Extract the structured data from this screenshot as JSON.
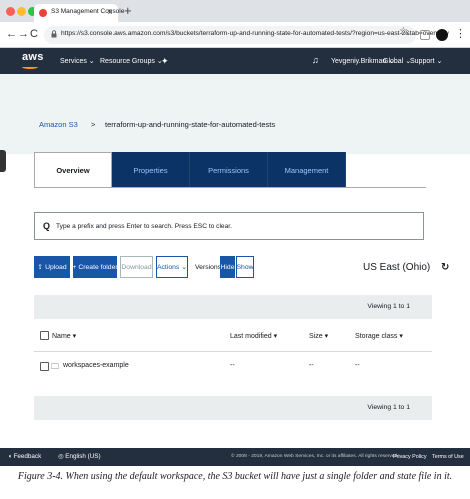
{
  "browser": {
    "tab_title": "S3 Management Console",
    "tab_close": "x",
    "new_tab": "+",
    "url": "https://s3.console.aws.amazon.com/s3/buckets/terraform-up-and-running-state-for-automated-tests/?region=us-east-2&tab=overview",
    "traffic_colors": [
      "#ff5f57",
      "#febc2e",
      "#28c840"
    ]
  },
  "aws_nav": {
    "logo": "aws",
    "services": "Services",
    "resource_groups": "Resource Groups",
    "user": "Yevgeniy.Brikman",
    "region": "Global",
    "support": "Support",
    "background": "#232f3e",
    "accent": "#ff9900"
  },
  "breadcrumb": {
    "root": "Amazon S3",
    "separator": ">",
    "bucket": "terraform-up-and-running-state-for-automated-tests"
  },
  "tabs": [
    {
      "label": "Overview",
      "active": true
    },
    {
      "label": "Properties",
      "active": false
    },
    {
      "label": "Permissions",
      "active": false
    },
    {
      "label": "Management",
      "active": false
    }
  ],
  "search": {
    "icon": "search-icon",
    "placeholder": "Type a prefix and press Enter to search. Press ESC to clear."
  },
  "toolbar": {
    "upload": "Upload",
    "create_folder": "Create folder",
    "download": "Download",
    "actions": "Actions",
    "versions_label": "Versions",
    "hide": "Hide",
    "show": "Show",
    "region": "US East (Ohio)"
  },
  "table": {
    "viewing_top": "Viewing 1 to 1",
    "viewing_bottom": "Viewing 1 to 1",
    "columns": {
      "name": "Name",
      "last_modified": "Last modified",
      "size": "Size",
      "storage_class": "Storage class"
    },
    "rows": [
      {
        "name": "workspaces-example",
        "last_modified": "--",
        "size": "--",
        "storage_class": "--",
        "icon": "folder-icon"
      }
    ]
  },
  "footer": {
    "feedback": "Feedback",
    "language": "English (US)",
    "copyright": "© 2008 - 2019, Amazon Web Services, Inc. or its affiliates. All rights reserved.",
    "privacy": "Privacy Policy",
    "terms": "Terms of Use"
  },
  "caption": "Figure 3-4. When using the default workspace, the S3 bucket will have just a single folder and state file in it."
}
